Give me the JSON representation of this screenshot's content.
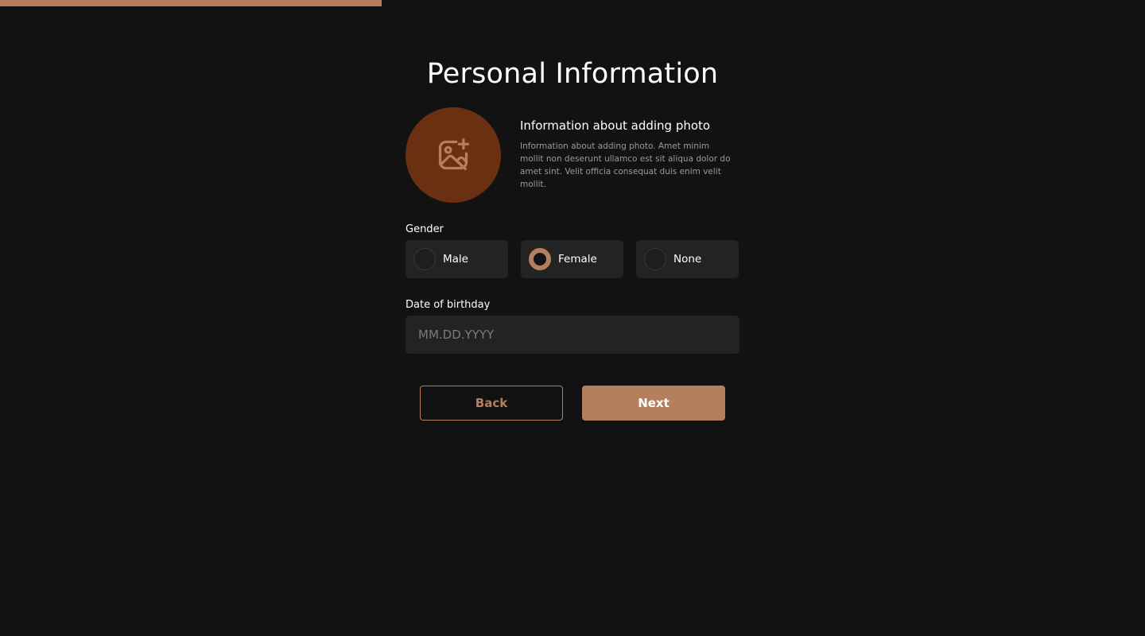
{
  "progress": {
    "fraction": 0.333,
    "color": "#b47f5e"
  },
  "page": {
    "title": "Personal Information"
  },
  "photo": {
    "icon": "image-add-icon",
    "background_color": "#6b2f12",
    "info_title": "Information about adding photo",
    "info_text": "Information about adding photo. Amet minim mollit non deserunt ullamco est sit aliqua dolor do amet sint. Velit officia consequat duis enim velit mollit."
  },
  "gender": {
    "label": "Gender",
    "selected": "Female",
    "options": [
      {
        "label": "Male",
        "checked": false
      },
      {
        "label": "Female",
        "checked": true
      },
      {
        "label": "None",
        "checked": false
      }
    ]
  },
  "birthday": {
    "label": "Date of birthday",
    "value": "",
    "placeholder": "MM.DD.YYYY"
  },
  "actions": {
    "back_label": "Back",
    "next_label": "Next"
  },
  "colors": {
    "accent": "#b47f5e",
    "background": "#121212",
    "field_background": "#232323"
  }
}
